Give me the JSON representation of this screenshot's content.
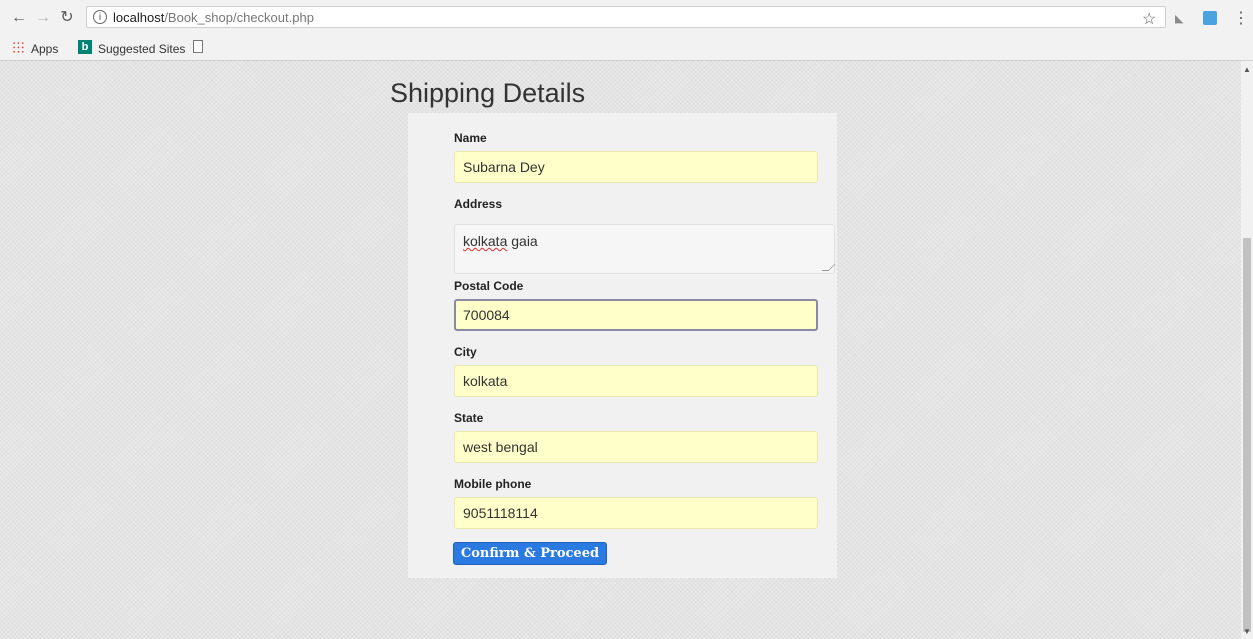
{
  "browser": {
    "url_host": "localhost",
    "url_path": "/Book_shop/checkout.php",
    "bookmarks": [
      "Apps",
      "Suggested Sites"
    ]
  },
  "page": {
    "title": "Shipping Details",
    "form": {
      "name_label": "Name",
      "name_value": "Subarna Dey",
      "address_label": "Address",
      "address_word1": "kolkata",
      "address_word2": " gaia",
      "postal_label": "Postal Code",
      "postal_value": "700084",
      "city_label": "City",
      "city_value": "kolkata",
      "state_label": "State",
      "state_value": "west bengal",
      "mobile_label": "Mobile phone",
      "mobile_value": "9051118114",
      "submit_label": "Confirm & Proceed"
    }
  },
  "colors": {
    "field_bg": "#ffffc9",
    "button_bg": "#2a7ae2"
  }
}
